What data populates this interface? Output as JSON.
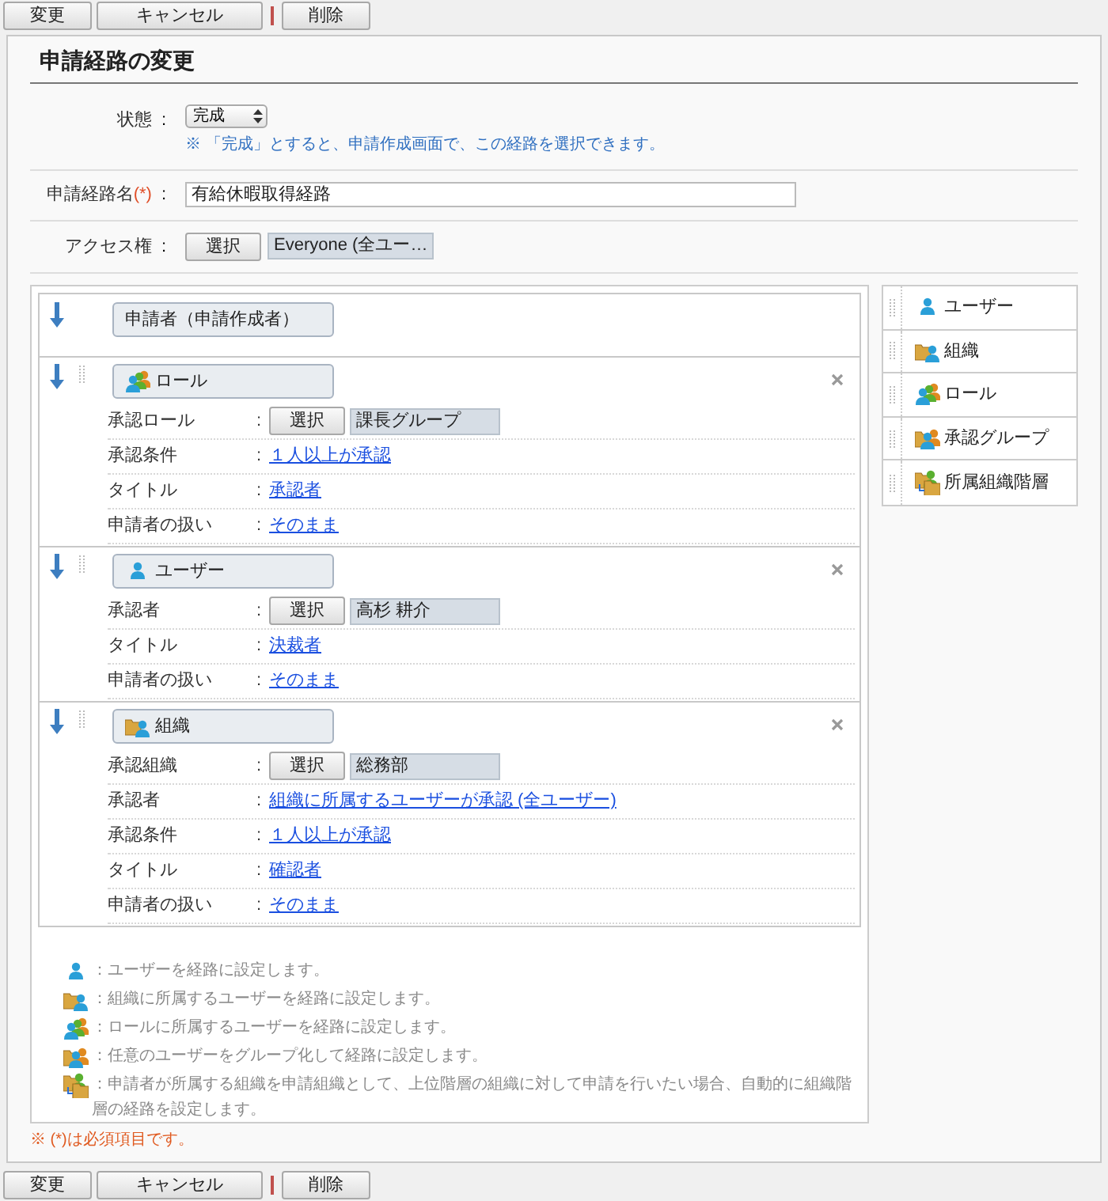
{
  "toolbar_top": {
    "buttons": [
      {
        "label": "変更",
        "kind": "normal"
      },
      {
        "label": "キャンセル",
        "kind": "normal"
      },
      {
        "label": "削除",
        "kind": "separated"
      }
    ]
  },
  "title": "申請経路の変更",
  "form": {
    "status": {
      "label": "状態",
      "sep": ":",
      "value": "完成",
      "note": "※ 「完成」とすると、申請作成画面で、この経路を選択できます。"
    },
    "route_name": {
      "label": "申請経路名",
      "required_mark": "(*)",
      "sep": ":",
      "value": "有給休暇取得経路"
    },
    "access": {
      "label": "アクセス権",
      "sep": ":",
      "button": "選択",
      "value": "Everyone (全ユー…"
    }
  },
  "steps": [
    {
      "kind": "applicant",
      "label": "申請者（申請作成者）"
    },
    {
      "kind": "role",
      "label": "ロール",
      "rows": [
        {
          "label": "承認ロール",
          "sep": ":",
          "kind": "picker",
          "button": "選択",
          "value": "課長グループ"
        },
        {
          "label": "承認条件",
          "sep": ":",
          "kind": "link",
          "value": "１人以上が承認"
        },
        {
          "label": "タイトル",
          "sep": ":",
          "kind": "link",
          "value": "承認者"
        },
        {
          "label": "申請者の扱い",
          "sep": ":",
          "kind": "link",
          "value": "そのまま"
        }
      ]
    },
    {
      "kind": "user",
      "label": "ユーザー",
      "rows": [
        {
          "label": "承認者",
          "sep": ":",
          "kind": "picker",
          "button": "選択",
          "value": "高杉 耕介"
        },
        {
          "label": "タイトル",
          "sep": ":",
          "kind": "link",
          "value": "決裁者"
        },
        {
          "label": "申請者の扱い",
          "sep": ":",
          "kind": "link",
          "value": "そのまま"
        }
      ]
    },
    {
      "kind": "org",
      "label": "組織",
      "rows": [
        {
          "label": "承認組織",
          "sep": ":",
          "kind": "picker",
          "button": "選択",
          "value": "総務部"
        },
        {
          "label": "承認者",
          "sep": ":",
          "kind": "link",
          "value": "組織に所属するユーザーが承認 (全ユーザー)"
        },
        {
          "label": "承認条件",
          "sep": ":",
          "kind": "link",
          "value": "１人以上が承認"
        },
        {
          "label": "タイトル",
          "sep": ":",
          "kind": "link",
          "value": "確認者"
        },
        {
          "label": "申請者の扱い",
          "sep": ":",
          "kind": "link",
          "value": "そのまま"
        }
      ]
    }
  ],
  "palette": [
    {
      "kind": "user",
      "label": "ユーザー"
    },
    {
      "kind": "org",
      "label": "組織"
    },
    {
      "kind": "role",
      "label": "ロール"
    },
    {
      "kind": "group",
      "label": "承認グループ"
    },
    {
      "kind": "hierarchy",
      "label": "所属組織階層"
    }
  ],
  "legend": [
    {
      "kind": "user",
      "text": "：ユーザーを経路に設定します。"
    },
    {
      "kind": "org",
      "text": "：組織に所属するユーザーを経路に設定します。"
    },
    {
      "kind": "role",
      "text": "：ロールに所属するユーザーを経路に設定します。"
    },
    {
      "kind": "group",
      "text": "：任意のユーザーをグループ化して経路に設定します。"
    },
    {
      "kind": "hierarchy",
      "text": "：申請者が所属する組織を申請組織として、上位階層の組織に対して申請を行いたい場合、自動的に組織階層の経路を設定します。"
    }
  ],
  "required_note": "※ (*)は必須項目です。",
  "toolbar_bottom": {
    "buttons": [
      {
        "label": "変更",
        "kind": "normal"
      },
      {
        "label": "キャンセル",
        "kind": "normal"
      },
      {
        "label": "削除",
        "kind": "separated"
      }
    ]
  }
}
